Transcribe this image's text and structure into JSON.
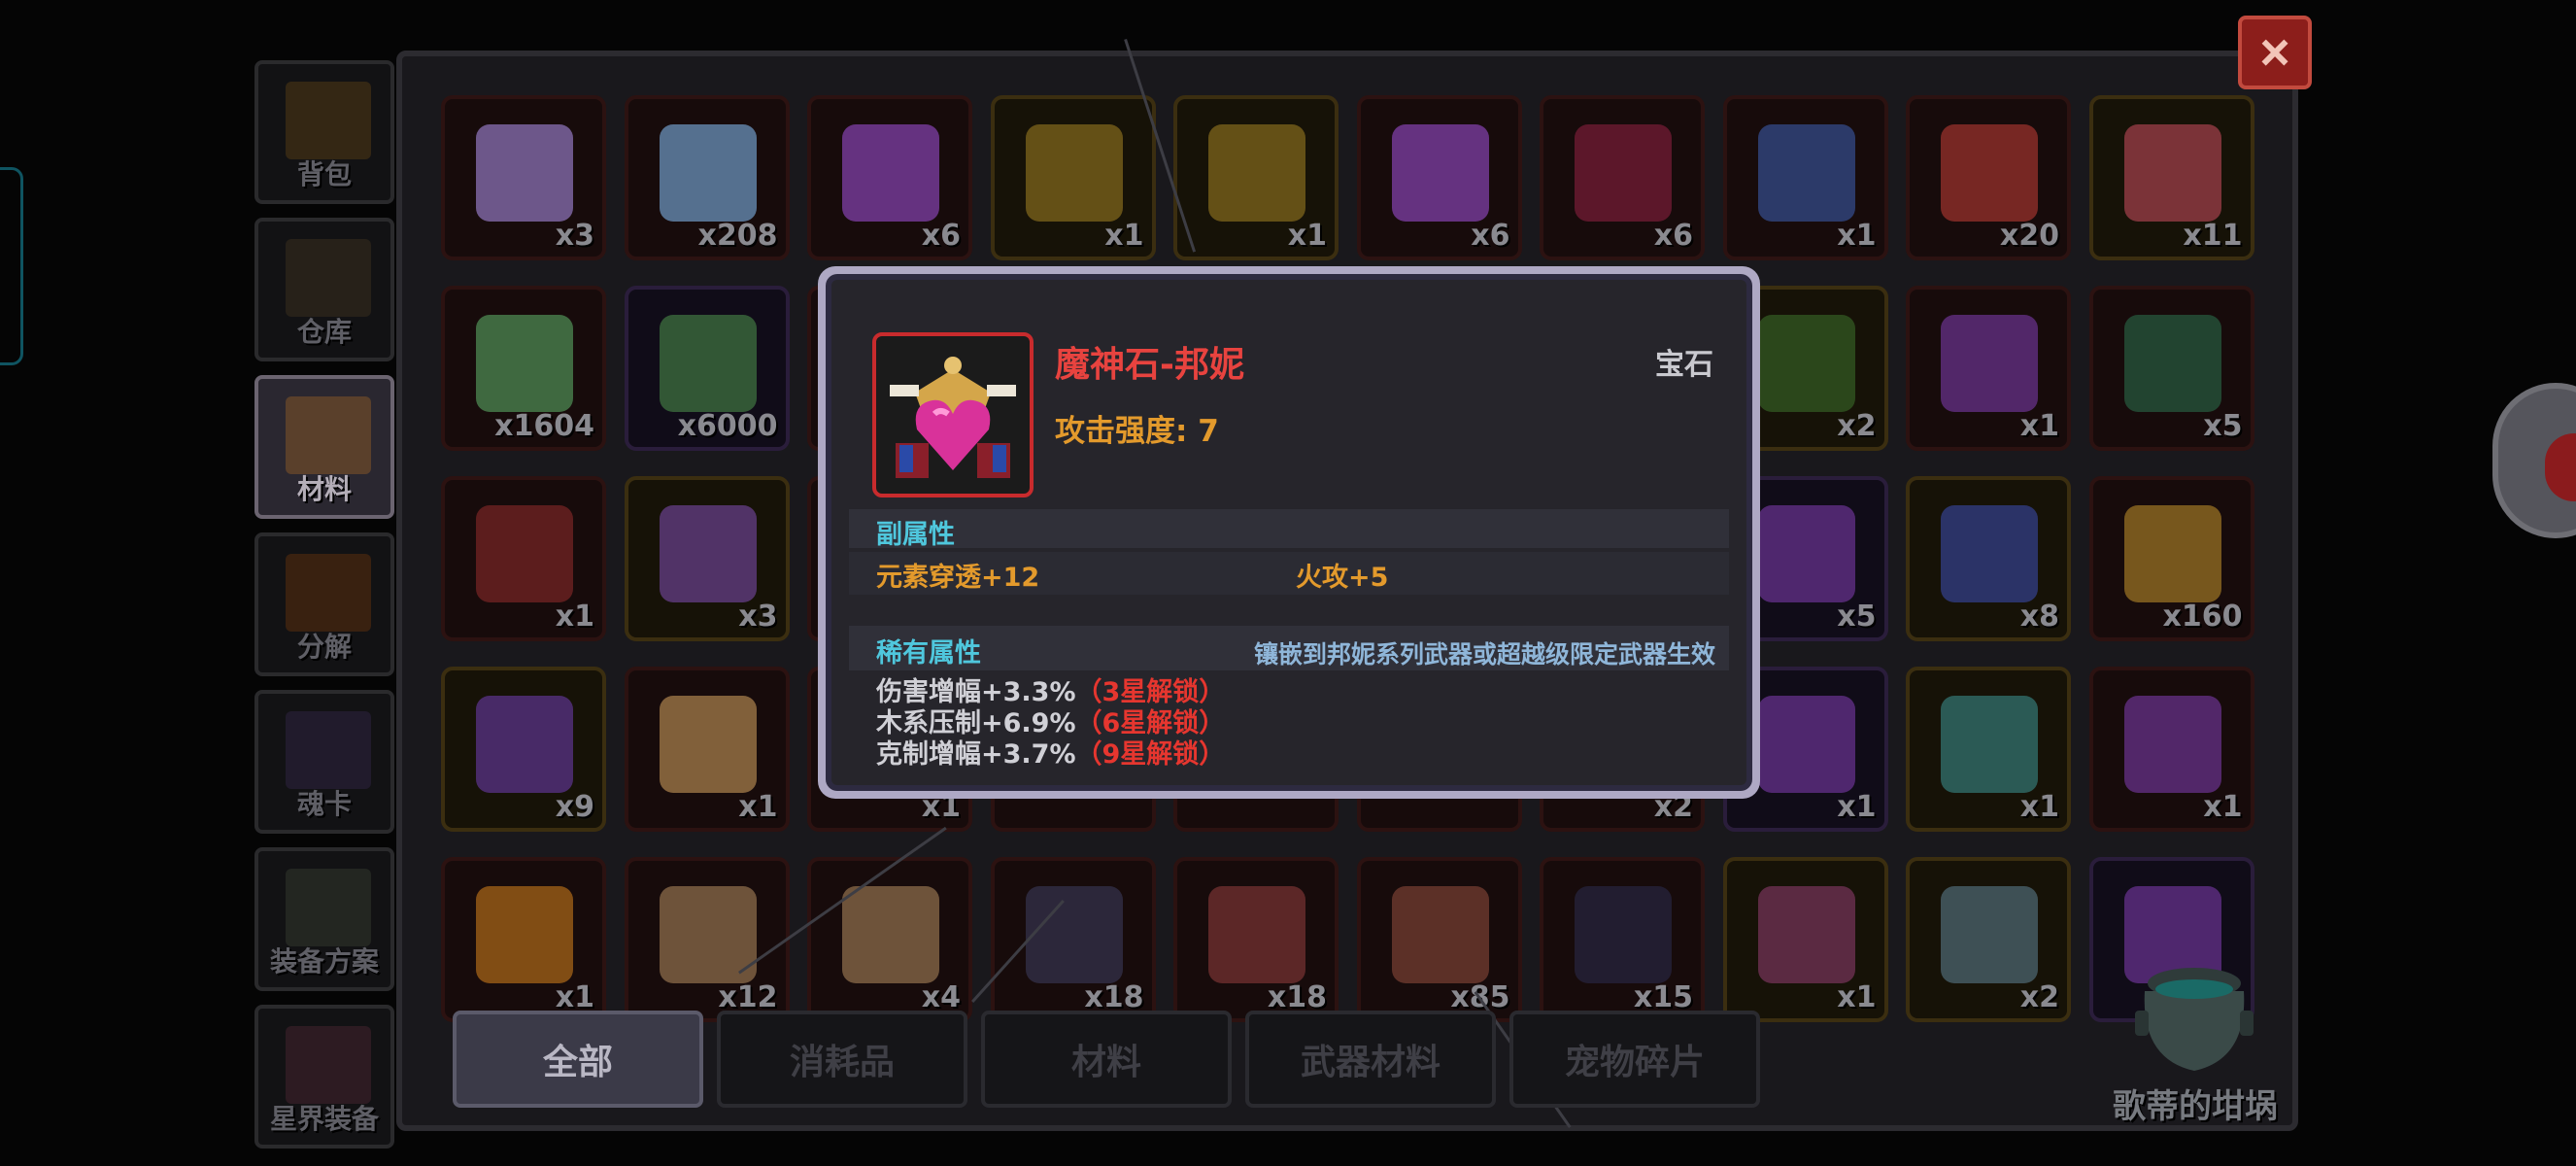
{
  "sidebar": {
    "tabs": [
      {
        "label": "背包",
        "icon": "chest-icon",
        "color": "#6b4a16",
        "active": false
      },
      {
        "label": "仓库",
        "icon": "warehouse-chest-icon",
        "color": "#4a3a22",
        "active": false
      },
      {
        "label": "材料",
        "icon": "material-frame-icon",
        "color": "#6b4a2a",
        "active": true
      },
      {
        "label": "分解",
        "icon": "cauldron-icon",
        "color": "#7a3b0a",
        "active": false
      },
      {
        "label": "魂卡",
        "icon": "soul-card-icon",
        "color": "#3a2a55",
        "active": false
      },
      {
        "label": "装备方案",
        "icon": "armor-set-icon",
        "color": "#3e4636",
        "active": false
      },
      {
        "label": "星界装备",
        "icon": "astral-gear-icon",
        "color": "#5a2a3a",
        "active": false
      }
    ]
  },
  "inventory": {
    "rows": [
      [
        {
          "icon": "purple-orb-icon",
          "count": "x3",
          "rarity": "red",
          "color": "#a78be0"
        },
        {
          "icon": "blue-crystal-icon",
          "count": "x208",
          "rarity": "red",
          "color": "#7fb4e8"
        },
        {
          "icon": "purple-key-icon",
          "count": "x6",
          "rarity": "red",
          "color": "#9a4ccf"
        },
        {
          "icon": "gold-chest-icon",
          "count": "x1",
          "rarity": "gold",
          "color": "#9a7a22"
        },
        {
          "icon": "gold-chest-icon",
          "count": "x1",
          "rarity": "gold",
          "color": "#9a7a22"
        },
        {
          "icon": "purple-gold-key-icon",
          "count": "x6",
          "rarity": "red",
          "color": "#9a4ccf"
        },
        {
          "icon": "demon-mask-icon",
          "count": "x6",
          "rarity": "red",
          "color": "#8a2040"
        },
        {
          "icon": "blue-gem-scroll-icon",
          "count": "x1",
          "rarity": "red",
          "color": "#3a5aa8"
        },
        {
          "icon": "red-crab-icon",
          "count": "x20",
          "rarity": "red",
          "color": "#b83a34"
        },
        {
          "icon": "hat-book-icon",
          "count": "x11",
          "rarity": "gold",
          "color": "#c04a5a"
        }
      ],
      [
        {
          "icon": "rainbow-crystal-icon",
          "count": "x1604",
          "rarity": "red",
          "color": "#5aa864"
        },
        {
          "icon": "tri-orb-icon",
          "count": "x6000",
          "rarity": "purple",
          "color": "#4a8a4a"
        },
        {
          "icon": "",
          "count": "",
          "rarity": "red",
          "color": "#1a1010"
        },
        {
          "icon": "",
          "count": "",
          "rarity": "red",
          "color": "#1a1010"
        },
        {
          "icon": "",
          "count": "",
          "rarity": "red",
          "color": "#1a1010"
        },
        {
          "icon": "",
          "count": "",
          "rarity": "red",
          "color": "#1a1010"
        },
        {
          "icon": "",
          "count": "",
          "rarity": "red",
          "color": "#1a1010"
        },
        {
          "icon": "green-leaf-icon",
          "count": "x2",
          "rarity": "gold",
          "color": "#3a6a2a"
        },
        {
          "icon": "purple-chest-icon",
          "count": "x1",
          "rarity": "red",
          "color": "#7a3aa8"
        },
        {
          "icon": "jade-ring-icon",
          "count": "x5",
          "rarity": "red",
          "color": "#2a6a4a"
        }
      ],
      [
        {
          "icon": "red-hook-icon",
          "count": "x1",
          "rarity": "red",
          "color": "#8a2a2a"
        },
        {
          "icon": "violet-chest-icon",
          "count": "x3",
          "rarity": "gold",
          "color": "#7a4aa8"
        },
        {
          "icon": "",
          "count": "",
          "rarity": "red",
          "color": "#1a1010"
        },
        {
          "icon": "",
          "count": "",
          "rarity": "red",
          "color": "#1a1010"
        },
        {
          "icon": "",
          "count": "",
          "rarity": "red",
          "color": "#1a1010"
        },
        {
          "icon": "",
          "count": "",
          "rarity": "red",
          "color": "#1a1010"
        },
        {
          "icon": "",
          "count": "",
          "rarity": "red",
          "color": "#1a1010"
        },
        {
          "icon": "mystery-card-icon",
          "count": "x5",
          "rarity": "purple",
          "color": "#7a3aa8"
        },
        {
          "icon": "blue-tome-icon",
          "count": "x8",
          "rarity": "gold",
          "color": "#3a4aa8"
        },
        {
          "icon": "gold-coin-icon",
          "count": "x160",
          "rarity": "red",
          "color": "#b88a2a"
        }
      ],
      [
        {
          "icon": "purple-badge-icon",
          "count": "x9",
          "rarity": "gold",
          "color": "#6a3aa8"
        },
        {
          "icon": "hero-card-icon",
          "count": "x1",
          "rarity": "red",
          "color": "#c89a5a"
        },
        {
          "icon": "",
          "count": "x1",
          "rarity": "red",
          "color": "#1a1010"
        },
        {
          "icon": "",
          "count": "",
          "rarity": "red",
          "color": "#1a1010"
        },
        {
          "icon": "",
          "count": "",
          "rarity": "red",
          "color": "#1a1010"
        },
        {
          "icon": "",
          "count": "",
          "rarity": "red",
          "color": "#1a1010"
        },
        {
          "icon": "",
          "count": "x2",
          "rarity": "red",
          "color": "#1a1010"
        },
        {
          "icon": "mystery-card-icon",
          "count": "x1",
          "rarity": "purple",
          "color": "#7a3aa8"
        },
        {
          "icon": "beast-emblem-icon",
          "count": "x1",
          "rarity": "gold",
          "color": "#3a8a8a"
        },
        {
          "icon": "mystery-card-icon",
          "count": "x1",
          "rarity": "red",
          "color": "#7a3aa8"
        }
      ],
      [
        {
          "icon": "gold-treasure-icon",
          "count": "x1",
          "rarity": "red",
          "color": "#c87a1a"
        },
        {
          "icon": "knight-card-icon",
          "count": "x12",
          "rarity": "red",
          "color": "#a8845a"
        },
        {
          "icon": "knight-card-icon",
          "count": "x4",
          "rarity": "red",
          "color": "#a8845a"
        },
        {
          "icon": "dark-knight-card-icon",
          "count": "x18",
          "rarity": "red",
          "color": "#3a3a5a"
        },
        {
          "icon": "red-knight-card-icon",
          "count": "x18",
          "rarity": "red",
          "color": "#8a3a3a"
        },
        {
          "icon": "red-knight-card-icon",
          "count": "x85",
          "rarity": "red",
          "color": "#8a4a3a"
        },
        {
          "icon": "dark-mage-card-icon",
          "count": "x15",
          "rarity": "red",
          "color": "#2a2a4a"
        },
        {
          "icon": "crest-icon",
          "count": "x1",
          "rarity": "gold",
          "color": "#8a3a6a"
        },
        {
          "icon": "silver-emblem-icon",
          "count": "x2",
          "rarity": "gold",
          "color": "#5a7a8a"
        },
        {
          "icon": "mystery-card-icon",
          "count": "",
          "rarity": "purple",
          "color": "#7a3aa8"
        }
      ]
    ]
  },
  "filters": [
    {
      "label": "全部",
      "active": true
    },
    {
      "label": "消耗品",
      "active": false
    },
    {
      "label": "材料",
      "active": false
    },
    {
      "label": "武器材料",
      "active": false
    },
    {
      "label": "宠物碎片",
      "active": false
    }
  ],
  "close_label": "×",
  "goette_label": "歌蒂的坩埚",
  "tooltip": {
    "name": "魔神石-邦妮",
    "category": "宝石",
    "main_stat": "攻击强度: 7",
    "icon": "demon-heart-gem-icon",
    "sub_title": "副属性",
    "sub_stats": [
      "元素穿透+12",
      "火攻+5"
    ],
    "rare_title": "稀有属性",
    "rare_note": "镶嵌到邦妮系列武器或超越级限定武器生效",
    "rare_lines": [
      {
        "text": "伤害增幅+3.3%",
        "lock": "（3星解锁）"
      },
      {
        "text": "木系压制+6.9%",
        "lock": "（6星解锁）"
      },
      {
        "text": "克制增幅+3.7%",
        "lock": "（9星解锁）"
      }
    ]
  }
}
